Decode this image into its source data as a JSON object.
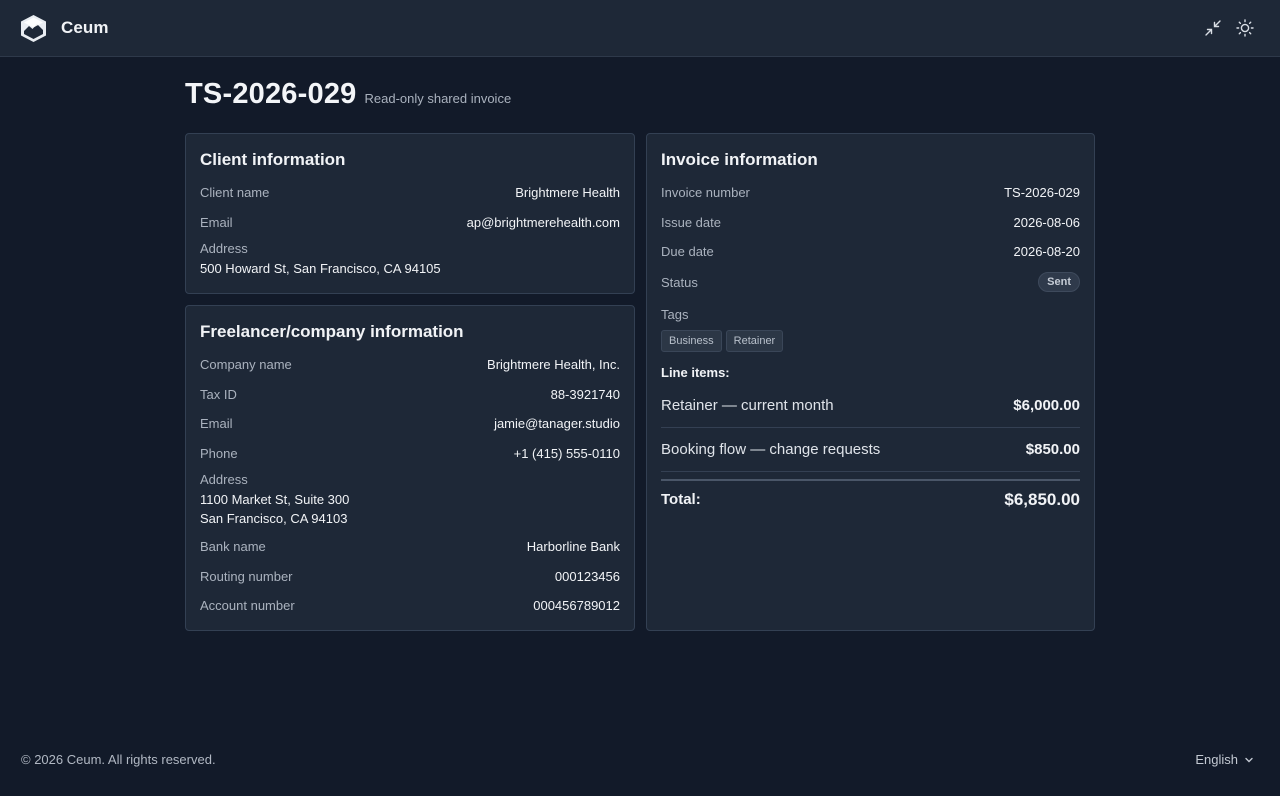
{
  "app": {
    "name": "Ceum"
  },
  "header": {
    "collapse_icon": "minimize-icon",
    "theme_icon": "sun-icon"
  },
  "page": {
    "title": "TS-2026-029",
    "subtitle": "Read-only shared invoice"
  },
  "client": {
    "title": "Client information",
    "name_label": "Client name",
    "name": "Brightmere Health",
    "email_label": "Email",
    "email": "ap@brightmerehealth.com",
    "address_label": "Address",
    "address": "500 Howard St, San Francisco, CA 94105"
  },
  "company": {
    "title": "Freelancer/company information",
    "name_label": "Company name",
    "name": "Brightmere Health, Inc.",
    "tax_label": "Tax ID",
    "tax": "88-3921740",
    "email_label": "Email",
    "email": "jamie@tanager.studio",
    "phone_label": "Phone",
    "phone": "+1 (415) 555-0110",
    "address_label": "Address",
    "address_line1": "1100 Market St, Suite 300",
    "address_line2": "San Francisco, CA 94103",
    "bank_label": "Bank name",
    "bank": "Harborline Bank",
    "routing_label": "Routing number",
    "routing": "000123456",
    "account_label": "Account number",
    "account": "000456789012"
  },
  "invoice": {
    "title": "Invoice information",
    "number_label": "Invoice number",
    "number": "TS-2026-029",
    "issue_label": "Issue date",
    "issue": "2026-08-06",
    "due_label": "Due date",
    "due": "2026-08-20",
    "status_label": "Status",
    "status": "Sent",
    "tags_label": "Tags",
    "tags": [
      "Business",
      "Retainer"
    ],
    "line_items_label": "Line items:",
    "line_items": [
      {
        "description": "Retainer — current month",
        "amount": "$6,000.00"
      },
      {
        "description": "Booking flow — change requests",
        "amount": "$850.00"
      }
    ],
    "total_label": "Total:",
    "total": "$6,850.00"
  },
  "footer": {
    "copyright": "© 2026 Ceum. All rights reserved.",
    "language": "English"
  },
  "colors": {
    "background": "#121a29",
    "card": "#1e2837",
    "border": "#334053"
  }
}
